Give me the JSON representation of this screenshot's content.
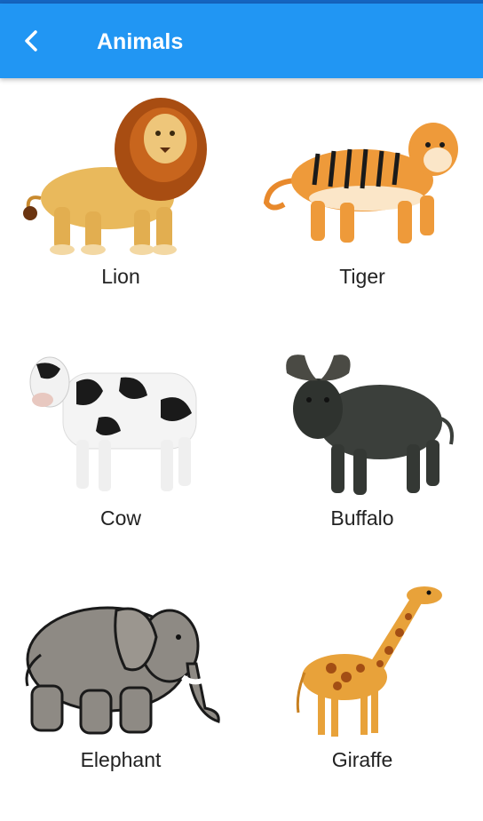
{
  "app_bar": {
    "title": "Animals",
    "back_icon": "arrow-back-icon"
  },
  "colors": {
    "app_bar": "#2196f3",
    "status_bar": "#1565c0"
  },
  "animals": [
    {
      "label": "Lion",
      "icon": "lion-image"
    },
    {
      "label": "Tiger",
      "icon": "tiger-image"
    },
    {
      "label": "Cow",
      "icon": "cow-image"
    },
    {
      "label": "Buffalo",
      "icon": "buffalo-image"
    },
    {
      "label": "Elephant",
      "icon": "elephant-image"
    },
    {
      "label": "Giraffe",
      "icon": "giraffe-image"
    }
  ]
}
